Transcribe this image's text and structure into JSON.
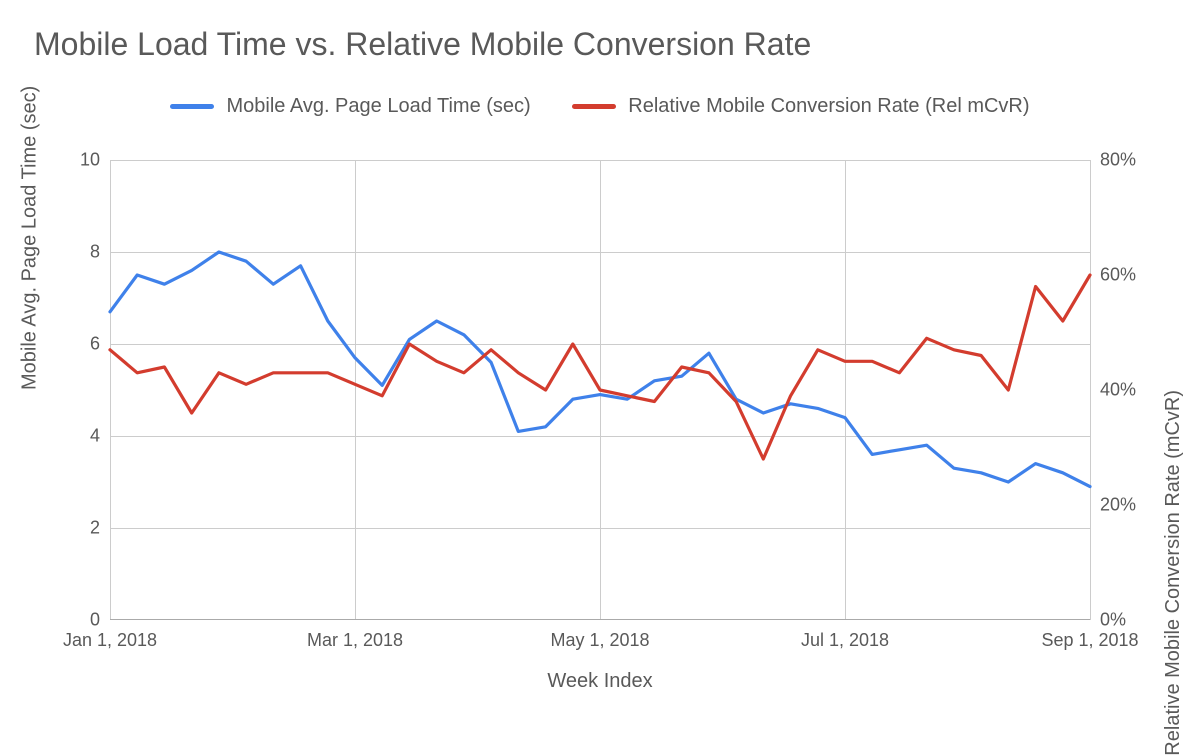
{
  "title": "Mobile Load Time vs. Relative Mobile Conversion Rate",
  "legend": {
    "series1": "Mobile Avg. Page Load Time (sec)",
    "series2": "Relative Mobile Conversion Rate (Rel mCvR)"
  },
  "axes": {
    "xlabel": "Week Index",
    "ylabel_left": "Mobile Avg. Page Load Time (sec)",
    "ylabel_right": "Relative Mobile Conversion Rate (mCvR)",
    "xticks": [
      "Jan 1, 2018",
      "Mar 1, 2018",
      "May 1, 2018",
      "Jul 1, 2018",
      "Sep 1, 2018"
    ],
    "yticks_left": [
      "0",
      "2",
      "4",
      "6",
      "8",
      "10"
    ],
    "yticks_right": [
      "0%",
      "20%",
      "40%",
      "60%",
      "80%"
    ]
  },
  "chart_data": {
    "type": "line",
    "xlabel": "Week Index",
    "x_ticks": [
      "Jan 1, 2018",
      "Mar 1, 2018",
      "May 1, 2018",
      "Jul 1, 2018",
      "Sep 1, 2018"
    ],
    "x_index": [
      0,
      1,
      2,
      3,
      4,
      5,
      6,
      7,
      8,
      9,
      10,
      11,
      12,
      13,
      14,
      15,
      16,
      17,
      18,
      19,
      20,
      21,
      22,
      23,
      24,
      25,
      26,
      27,
      28,
      29,
      30,
      31,
      32,
      33,
      34,
      35,
      36
    ],
    "series": [
      {
        "name": "Mobile Avg. Page Load Time (sec)",
        "axis": "left",
        "ylabel": "Mobile Avg. Page Load Time (sec)",
        "ylim": [
          0,
          10
        ],
        "color": "#3f81ea",
        "values": [
          6.7,
          7.5,
          7.3,
          7.6,
          8.0,
          7.8,
          7.3,
          7.7,
          6.5,
          5.7,
          5.1,
          6.1,
          6.5,
          6.2,
          5.6,
          4.1,
          4.2,
          4.8,
          4.9,
          4.8,
          5.2,
          5.3,
          5.8,
          4.8,
          4.5,
          4.7,
          4.6,
          4.4,
          3.6,
          3.7,
          3.8,
          3.3,
          3.2,
          3.0,
          3.4,
          3.2,
          2.9
        ]
      },
      {
        "name": "Relative Mobile Conversion Rate (Rel mCvR)",
        "axis": "right",
        "ylabel": "Relative Mobile Conversion Rate (mCvR)",
        "ylim": [
          0,
          80
        ],
        "unit": "%",
        "color": "#d33c2e",
        "values": [
          47,
          43,
          44,
          36,
          43,
          41,
          43,
          43,
          43,
          41,
          39,
          48,
          45,
          43,
          47,
          43,
          40,
          48,
          40,
          39,
          38,
          44,
          43,
          38,
          28,
          39,
          47,
          45,
          45,
          43,
          49,
          47,
          46,
          40,
          58,
          52,
          60
        ]
      }
    ]
  }
}
